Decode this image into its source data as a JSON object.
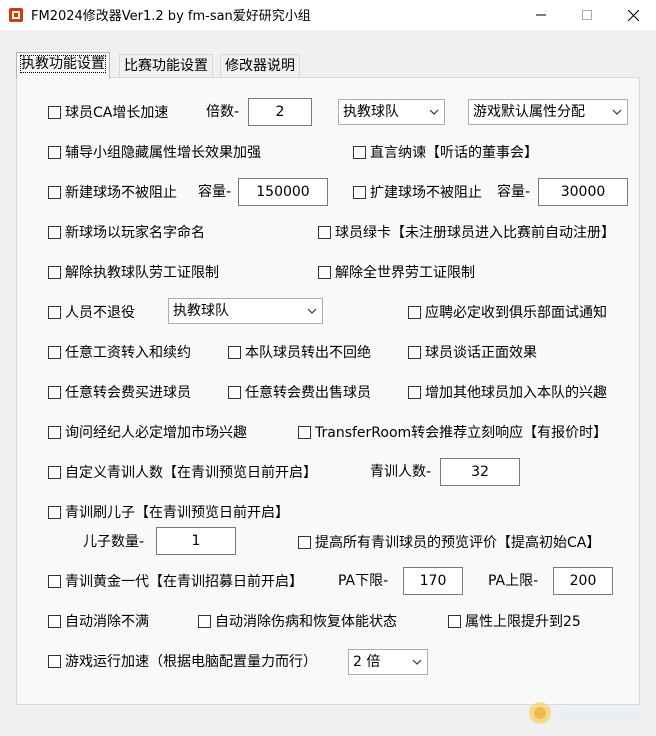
{
  "window": {
    "title": "FM2024修改器Ver1.2 by fm-san爱好研究小组"
  },
  "tabs": [
    {
      "label": "执教功能设置",
      "active": true
    },
    {
      "label": "比赛功能设置",
      "active": false
    },
    {
      "label": "修改器说明",
      "active": false
    }
  ],
  "panel": {
    "ca_growth": {
      "label": "球员CA增长加速",
      "checked": false
    },
    "multiplier_label": "倍数-",
    "multiplier_value": "2",
    "ca_team_select": "执教球队",
    "ca_dist_select": "游戏默认属性分配",
    "youth_hidden": {
      "label": "辅导小组隐藏属性增长效果加强",
      "checked": false
    },
    "direct_accept": {
      "label": "直言纳谏【听话的董事会】",
      "checked": false
    },
    "new_stadium": {
      "label": "新建球场不被阻止",
      "checked": false
    },
    "new_capacity_label": "容量-",
    "new_capacity_value": "150000",
    "expand_stadium": {
      "label": "扩建球场不被阻止",
      "checked": false
    },
    "expand_capacity_label": "容量-",
    "expand_capacity_value": "30000",
    "stadium_name": {
      "label": "新球场以玩家名字命名",
      "checked": false
    },
    "green_card": {
      "label": "球员绿卡【未注册球员进入比赛前自动注册】",
      "checked": false
    },
    "team_permit": {
      "label": "解除执教球队劳工证限制",
      "checked": false
    },
    "world_permit": {
      "label": "解除全世界劳工证限制",
      "checked": false
    },
    "no_retire": {
      "label": "人员不退役",
      "checked": false
    },
    "no_retire_select": "执教球队",
    "job_interview": {
      "label": "应聘必定收到俱乐部面试通知",
      "checked": false
    },
    "any_wage": {
      "label": "任意工资转入和续约",
      "checked": false
    },
    "no_refuse": {
      "label": "本队球员转出不回绝",
      "checked": false
    },
    "talk_positive": {
      "label": "球员谈话正面效果",
      "checked": false
    },
    "buy_any_fee": {
      "label": "任意转会费买进球员",
      "checked": false
    },
    "sell_any_fee": {
      "label": "任意转会费出售球员",
      "checked": false
    },
    "interest_join": {
      "label": "增加其他球员加入本队的兴趣",
      "checked": false
    },
    "agent_interest": {
      "label": "询问经纪人必定增加市场兴趣",
      "checked": false
    },
    "transferroom": {
      "label": "TransferRoom转会推荐立刻响应【有报价时】",
      "checked": false
    },
    "youth_count": {
      "label": "自定义青训人数【在青训预览日前开启】",
      "checked": false
    },
    "youth_count_label": "青训人数-",
    "youth_count_value": "32",
    "youth_son": {
      "label": "青训刷儿子【在青训预览日前开启】",
      "checked": false
    },
    "son_count_label": "儿子数量-",
    "son_count_value": "1",
    "youth_preview": {
      "label": "提高所有青训球员的预览评价【提高初始CA】",
      "checked": false
    },
    "golden_gen": {
      "label": "青训黄金一代【在青训招募日前开启】",
      "checked": false
    },
    "pa_min_label": "PA下限-",
    "pa_min_value": "170",
    "pa_max_label": "PA上限-",
    "pa_max_value": "200",
    "auto_unhappy": {
      "label": "自动消除不满",
      "checked": false
    },
    "auto_injury": {
      "label": "自动消除伤病和恢复体能状态",
      "checked": false
    },
    "attr_25": {
      "label": "属性上限提升到25",
      "checked": false
    },
    "speed_up": {
      "label": "游戏运行加速（根据电脑配置量力而行）",
      "checked": false
    },
    "speed_select": "2 倍"
  },
  "colors": {
    "title_bg": "#ffffff",
    "window_bg": "#f0f0f0",
    "panel_bg": "#f9f9f9"
  },
  "icons": [
    "app-icon",
    "minimize-icon",
    "maximize-icon",
    "close-icon",
    "chevron-down-icon"
  ]
}
